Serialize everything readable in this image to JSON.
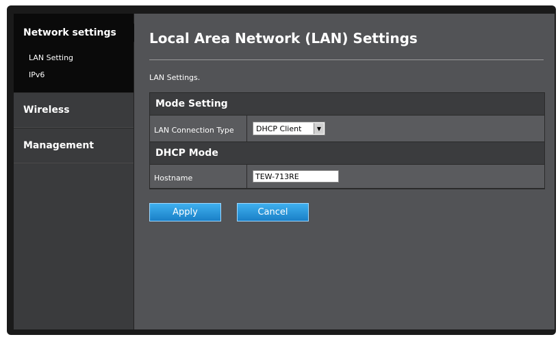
{
  "sidebar": {
    "active_group": "Network settings",
    "sub_items": [
      "LAN Setting",
      "IPv6"
    ],
    "groups": [
      "Wireless",
      "Management"
    ]
  },
  "main": {
    "title": "Local Area Network (LAN) Settings",
    "section_label": "LAN Settings.",
    "mode_setting_header": "Mode Setting",
    "lan_connection_label": "LAN Connection Type",
    "lan_connection_value": "DHCP Client",
    "dhcp_mode_header": "DHCP Mode",
    "hostname_label": "Hostname",
    "hostname_value": "TEW-713RE",
    "apply_label": "Apply",
    "cancel_label": "Cancel"
  },
  "colors": {
    "accent_button": "#2a96dc",
    "panel_bg": "#525356",
    "sidebar_bg": "#3a3b3d"
  }
}
